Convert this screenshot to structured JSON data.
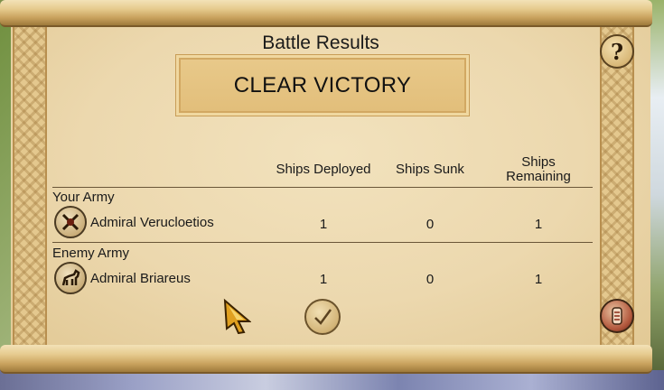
{
  "dialog": {
    "title": "Battle Results",
    "outcome": "CLEAR VICTORY",
    "help_label": "?"
  },
  "table": {
    "headers": {
      "deployed": "Ships Deployed",
      "sunk": "Ships Sunk",
      "remaining_line1": "Ships",
      "remaining_line2": "Remaining"
    },
    "your_army": {
      "label": "Your Army",
      "commander": "Admiral Verucloetios",
      "emblem_icon": "crossed-weapons-icon",
      "deployed": "1",
      "sunk": "0",
      "remaining": "1"
    },
    "enemy_army": {
      "label": "Enemy Army",
      "commander": "Admiral Briareus",
      "emblem_icon": "horse-icon",
      "deployed": "1",
      "sunk": "0",
      "remaining": "1"
    }
  },
  "controls": {
    "confirm_icon": "checkmark-icon",
    "cycle_icon": "scroll-cycle-icon",
    "cursor_icon": "pointer-arrow-icon"
  },
  "colors": {
    "parchment": "#ecd8ae",
    "banner": "#e4c080",
    "text": "#1a1a1a"
  }
}
